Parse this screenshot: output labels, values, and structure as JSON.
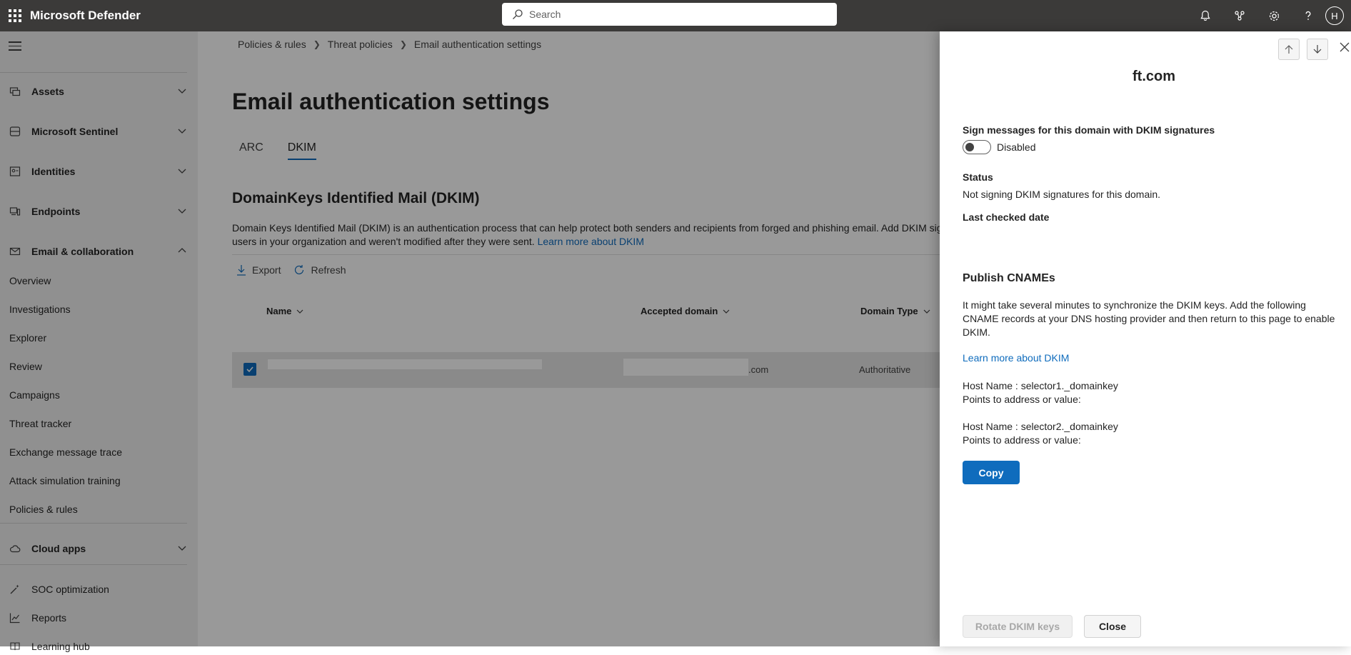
{
  "topbar": {
    "app_title": "Microsoft Defender",
    "search_placeholder": "Search",
    "avatar_initial": "H",
    "icons": [
      "app-launcher-icon",
      "bell-icon",
      "share-icon",
      "gear-icon",
      "help-icon"
    ]
  },
  "sidebar": {
    "groups": [
      {
        "label": "Assets",
        "icon": "assets-icon",
        "expanded": false
      },
      {
        "label": "Microsoft Sentinel",
        "icon": "sentinel-icon",
        "expanded": false
      },
      {
        "label": "Identities",
        "icon": "identities-icon",
        "expanded": false
      },
      {
        "label": "Endpoints",
        "icon": "endpoints-icon",
        "expanded": false
      },
      {
        "label": "Email & collaboration",
        "icon": "mail-icon",
        "expanded": true
      }
    ],
    "email_items": [
      "Overview",
      "Investigations",
      "Explorer",
      "Review",
      "Campaigns",
      "Threat tracker",
      "Exchange message trace",
      "Attack simulation training",
      "Policies & rules"
    ],
    "cloud_apps": "Cloud apps",
    "soc": "SOC optimization",
    "reports": "Reports",
    "learning": "Learning hub"
  },
  "main": {
    "breadcrumb": [
      "Policies & rules",
      "Threat policies",
      "Email authentication settings"
    ],
    "title": "Email authentication settings",
    "tabs": [
      "ARC",
      "DKIM"
    ],
    "active_tab": "DKIM",
    "section_title": "DomainKeys Identified Mail (DKIM)",
    "description_line1": "Domain Keys Identified Mail (DKIM) is an authentication process that can help protect both senders and recipients from forged and phishing email. Add DKIM sig",
    "description_line2": "users in your organization and weren't modified after they were sent.",
    "learn_more": "Learn more about DKIM",
    "toolbar": {
      "export": "Export",
      "refresh": "Refresh"
    },
    "columns": [
      "Name",
      "Accepted domain",
      "Domain Type"
    ],
    "row": {
      "domain_suffix": ".com",
      "domain_type": "Authoritative",
      "selected": true
    }
  },
  "panel": {
    "title": "ft.com",
    "sign_label": "Sign messages for this domain with DKIM signatures",
    "toggle_state": "Disabled",
    "status_label": "Status",
    "status_text": "Not signing DKIM signatures for this domain.",
    "last_checked_label": "Last checked date",
    "publish_title": "Publish CNAMEs",
    "publish_desc": "It might take several minutes to synchronize the DKIM keys. Add the following CNAME records at your DNS hosting provider and then return to this page to enable DKIM.",
    "learn_more": "Learn more about DKIM",
    "host1": "Host Name : selector1._domainkey",
    "points1": "Points to address or value:",
    "host2": "Host Name : selector2._domainkey",
    "points2": "Points to address or value:",
    "copy": "Copy",
    "rotate": "Rotate DKIM keys",
    "close": "Close"
  }
}
